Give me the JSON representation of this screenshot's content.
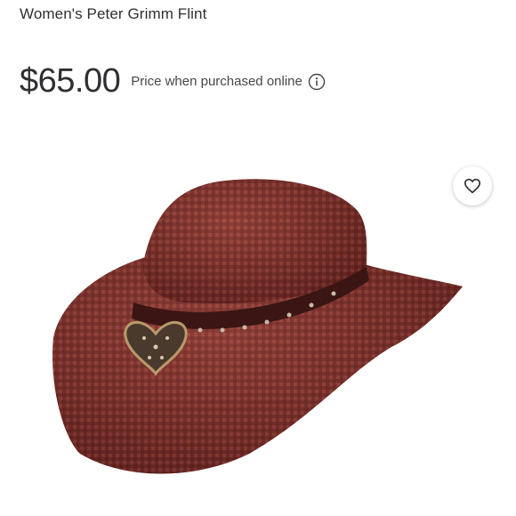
{
  "product": {
    "title": "Women's Peter Grimm Flint",
    "price": "$65.00",
    "price_note": "Price when purchased online"
  },
  "icons": {
    "info": "info-icon",
    "favorite": "heart-icon"
  },
  "colors": {
    "text": "#2e2f32",
    "hat_dark": "#5a1f1c",
    "hat_mid": "#8a3a33",
    "hat_light": "#a8544b"
  }
}
